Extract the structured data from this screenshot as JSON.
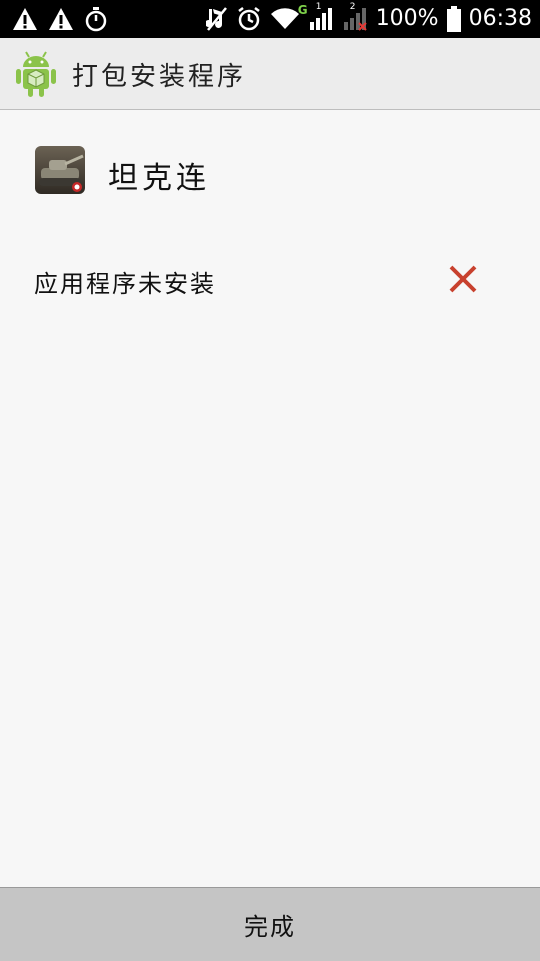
{
  "status_bar": {
    "battery": "100%",
    "time": "06:38",
    "sim1_label": "1",
    "sim2_label": "2",
    "network_label": "G",
    "icons": [
      "warning-icon",
      "warning-icon",
      "timer-icon",
      "mute-icon",
      "alarm-icon",
      "wifi-icon",
      "signal-icon",
      "signal-icon",
      "battery-icon"
    ]
  },
  "action_bar": {
    "title": "打包安装程序",
    "logo": "android-icon"
  },
  "content": {
    "app_name": "坦克连",
    "status_text": "应用程序未安装",
    "status_icon": "close-x-icon",
    "status_color": "#c8412e"
  },
  "footer": {
    "done_label": "完成"
  }
}
